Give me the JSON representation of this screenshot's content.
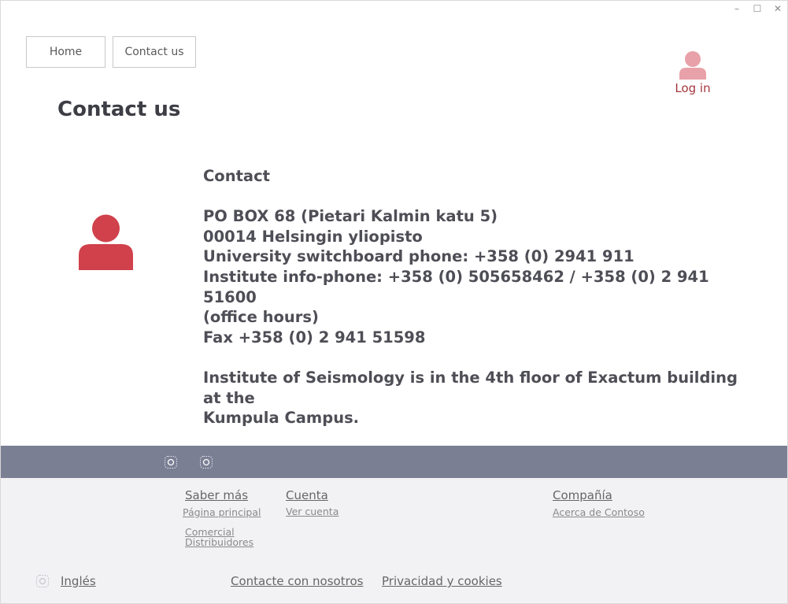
{
  "window_controls": {
    "minimize": "–",
    "maximize": "☐",
    "close": "✕"
  },
  "nav": {
    "home": "Home",
    "contact": "Contact us"
  },
  "login": {
    "label": "Log in"
  },
  "page": {
    "title": "Contact us"
  },
  "contact": {
    "heading": "Contact",
    "lines": [
      "PO BOX 68 (Pietari Kalmin katu 5)",
      "00014 Helsingin yliopisto",
      "University switchboard phone: +358 (0) 2941 911",
      "Institute info-phone: +358 (0) 505658462 / +358 (0) 2 941 51600",
      "(office hours)",
      "Fax +358 (0) 2 941 51598"
    ],
    "location_line1": "Institute of Seismology is in the 4th floor of Exactum building at the",
    "location_line2": "Kumpula Campus."
  },
  "footer": {
    "columns": {
      "learn": {
        "heading": "Saber más",
        "links": [
          "Página principal",
          "Comercial",
          "Distribuidores"
        ]
      },
      "account": {
        "heading": "Cuenta",
        "links": [
          "Ver cuenta"
        ]
      },
      "company": {
        "heading": "Compañía",
        "links": [
          "Acerca de Contoso"
        ]
      }
    },
    "language": "Inglés",
    "contact_link": "Contacte con nosotros",
    "privacy_link": "Privacidad y cookies"
  },
  "colors": {
    "accent": "#d0414b",
    "accent_light": "#e8a1a8",
    "footer_bar": "#7b7f94",
    "footer_bg": "#f2f2f4",
    "login_text": "#a3373f"
  }
}
